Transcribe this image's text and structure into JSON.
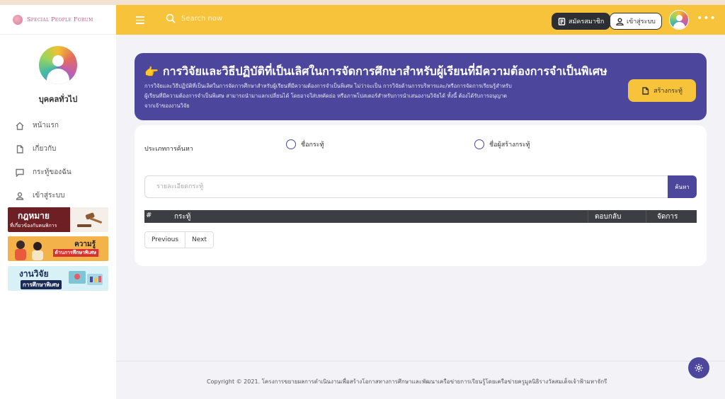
{
  "brand": {
    "name": "Special People Forum"
  },
  "sidebar": {
    "user_name": "บุคคลทั่วไป",
    "items": [
      {
        "label": "หน้าแรก",
        "icon": "home-icon"
      },
      {
        "label": "เกี่ยวกับ",
        "icon": "document-icon"
      },
      {
        "label": "กระทู้ของฉัน",
        "icon": "chat-icon"
      },
      {
        "label": "เข้าสู่ระบบ",
        "icon": "user-icon"
      }
    ],
    "banners": [
      {
        "title": "กฎหมาย",
        "subtitle": "ที่เกี่ยวข้องกับคนพิการ"
      },
      {
        "title": "ความรู้",
        "subtitle": "ด้านการศึกษาพิเศษ"
      },
      {
        "title": "งานวิจัย",
        "subtitle": "การศึกษาพิเศษ"
      }
    ]
  },
  "header": {
    "search_placeholder": "Search now",
    "register_label": "สมัครสมาชิก",
    "login_label": "เข้าสู่ระบบ",
    "more": "•••"
  },
  "hero": {
    "emoji": "👉",
    "title": "การวิจัยและวิธีปฏิบัติที่เป็นเลิศในการจัดการศึกษาสำหรับผู้เรียนที่มีความต้องการจำเป็นพิเศษ",
    "description": "การวิจัยและวิธีปฏิบัติที่เป็นเลิศในการจัดการศึกษาสำหรับผู้เรียนที่มีความต้องการจำเป็นพิเศษ ไม่ว่าจะเป็น การวิจัยด้านการบริหารและ/หรือการจัดการเรียนรู้สำหรับผู้เรียนที่มีความต้องการจำเป็นพิเศษ สามารถนำมาแลกเปลี่ยนได้ โดยอาจใส่บทคัดย่อ หรือภาพโปสเตอร์สำหรับการนำเสนองานวิจัยได้ ทั้งนี้ ต้องได้รับการอนุญาตจากเจ้าของงานวิจัย",
    "create_label": "สร้างกระทู้"
  },
  "search": {
    "type_label": "ประเภทการค้นหา",
    "option_topic": "ชื่อกระทู้",
    "option_author": "ชื่อผู้สร้างกระทู้",
    "detail_placeholder": "รายละเอียดกระทู้",
    "button_label": "ค้นหา"
  },
  "table": {
    "columns": [
      "#",
      "กระทู้",
      "ตอบกลับ",
      "จัดการ"
    ]
  },
  "pagination": {
    "previous": "Previous",
    "next": "Next"
  },
  "footer": {
    "copyright": "Copyright © 2021. โครงการขยายผลการดำเนินงานเพื่อสร้างโอกาสทางการศึกษาและพัฒนาเครือข่ายการเรียนรู้โดยเครือข่ายครูมูลนิธิรางวัลสมเด็จเจ้าฟ้ามหาจักรี"
  },
  "colors": {
    "header": "#f6c33a",
    "primary": "#4c479c",
    "dark": "#2e2e35"
  }
}
